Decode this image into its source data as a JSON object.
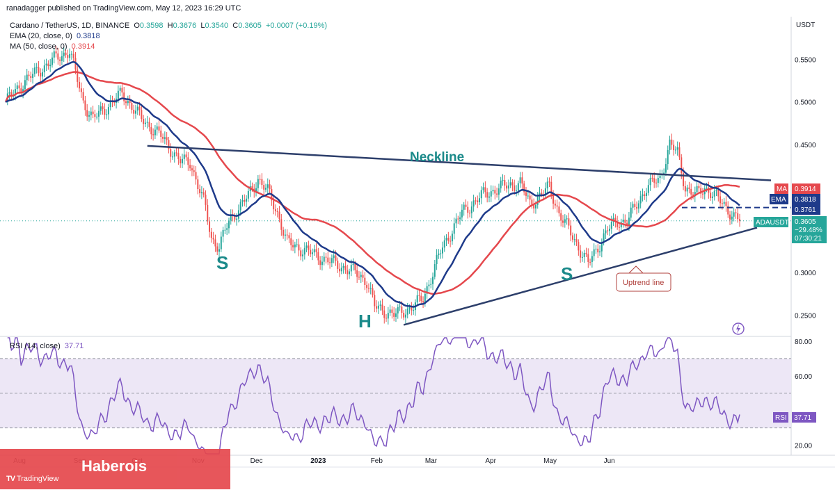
{
  "publisher": "ranadagger published on TradingView.com, May 12, 2023 16:29 UTC",
  "legend": {
    "symbol": "Cardano / TetherUS, 1D, BINANCE",
    "ohlc": {
      "O": "0.3598",
      "H": "0.3676",
      "L": "0.3540",
      "C": "0.3605",
      "change": "+0.0007 (+0.19%)"
    },
    "ema_label": "EMA (20, close, 0)",
    "ema_value": "0.3818",
    "ma_label": "MA (50, close, 0)",
    "ma_value": "0.3914"
  },
  "rsi_legend": {
    "label": "RSI (14, close)",
    "value": "37.71"
  },
  "currency": "USDT",
  "banner": "Haberois",
  "logo_text": "TradingView",
  "colors": {
    "up": "#26a69a",
    "down": "#ef5350",
    "ema": "#1e3a8a",
    "ma": "#e5484d",
    "trend": "#2d3f6b",
    "rsi": "#7e57c2",
    "rsi_band": "#ede7f6",
    "ticker": "#26a69a"
  },
  "chart_data": [
    {
      "type": "candlestick",
      "title": "Cardano / TetherUS, 1D, BINANCE",
      "ylim": [
        0.225,
        0.6
      ],
      "y_ticks": [
        "0.5500",
        "0.5000",
        "0.4500",
        "0.3000",
        "0.2500"
      ],
      "y_tick_values": [
        0.55,
        0.5,
        0.45,
        0.3,
        0.25
      ],
      "x_ticks": [
        "Aug",
        "Sep",
        "Oct",
        "Nov",
        "Dec",
        "2023",
        "Feb",
        "Mar",
        "Apr",
        "May",
        "Jun"
      ],
      "close_path": [
        [
          0,
          0.5
        ],
        [
          10,
          0.525
        ],
        [
          25,
          0.55
        ],
        [
          33,
          0.56
        ],
        [
          40,
          0.5
        ],
        [
          45,
          0.48
        ],
        [
          55,
          0.5
        ],
        [
          60,
          0.51
        ],
        [
          70,
          0.48
        ],
        [
          80,
          0.46
        ],
        [
          90,
          0.43
        ],
        [
          95,
          0.43
        ],
        [
          103,
          0.375
        ],
        [
          106,
          0.34
        ],
        [
          110,
          0.33
        ],
        [
          115,
          0.36
        ],
        [
          120,
          0.375
        ],
        [
          125,
          0.39
        ],
        [
          130,
          0.41
        ],
        [
          135,
          0.395
        ],
        [
          140,
          0.37
        ],
        [
          145,
          0.335
        ],
        [
          150,
          0.33
        ],
        [
          160,
          0.32
        ],
        [
          170,
          0.31
        ],
        [
          180,
          0.3
        ],
        [
          186,
          0.29
        ],
        [
          190,
          0.26
        ],
        [
          200,
          0.25
        ],
        [
          210,
          0.26
        ],
        [
          215,
          0.27
        ],
        [
          220,
          0.3
        ],
        [
          225,
          0.33
        ],
        [
          235,
          0.37
        ],
        [
          245,
          0.39
        ],
        [
          255,
          0.4
        ],
        [
          265,
          0.405
        ],
        [
          270,
          0.38
        ],
        [
          275,
          0.39
        ],
        [
          280,
          0.4
        ],
        [
          285,
          0.37
        ],
        [
          290,
          0.35
        ],
        [
          295,
          0.33
        ],
        [
          300,
          0.31
        ],
        [
          305,
          0.33
        ],
        [
          310,
          0.35
        ],
        [
          315,
          0.36
        ],
        [
          320,
          0.36
        ],
        [
          325,
          0.38
        ],
        [
          330,
          0.4
        ],
        [
          337,
          0.41
        ],
        [
          342,
          0.45
        ],
        [
          346,
          0.44
        ],
        [
          350,
          0.4
        ],
        [
          355,
          0.39
        ],
        [
          360,
          0.4
        ],
        [
          365,
          0.39
        ],
        [
          370,
          0.38
        ],
        [
          375,
          0.365
        ],
        [
          378,
          0.3605
        ]
      ],
      "last_price": {
        "ticker": "ADAUSDT",
        "price": "0.3605",
        "change": "−29.48%",
        "countdown": "07:30:21"
      },
      "indicators": {
        "ma": {
          "name": "MA",
          "value": "0.3914"
        },
        "ema": {
          "name": "EMA",
          "value": "0.3818"
        }
      },
      "horizontal_level": "0.3761",
      "annotations": {
        "neckline": "Neckline",
        "uptrend": "Uptrend line",
        "left_shoulder": "S",
        "head": "H",
        "right_shoulder": "S"
      }
    },
    {
      "type": "line",
      "title": "RSI (14, close)",
      "ylim": [
        15,
        82
      ],
      "y_ticks": [
        "80.00",
        "60.00",
        "20.00"
      ],
      "y_tick_values": [
        80,
        60,
        20
      ],
      "bands": [
        30,
        50,
        70
      ],
      "last_value": "37.71"
    }
  ]
}
